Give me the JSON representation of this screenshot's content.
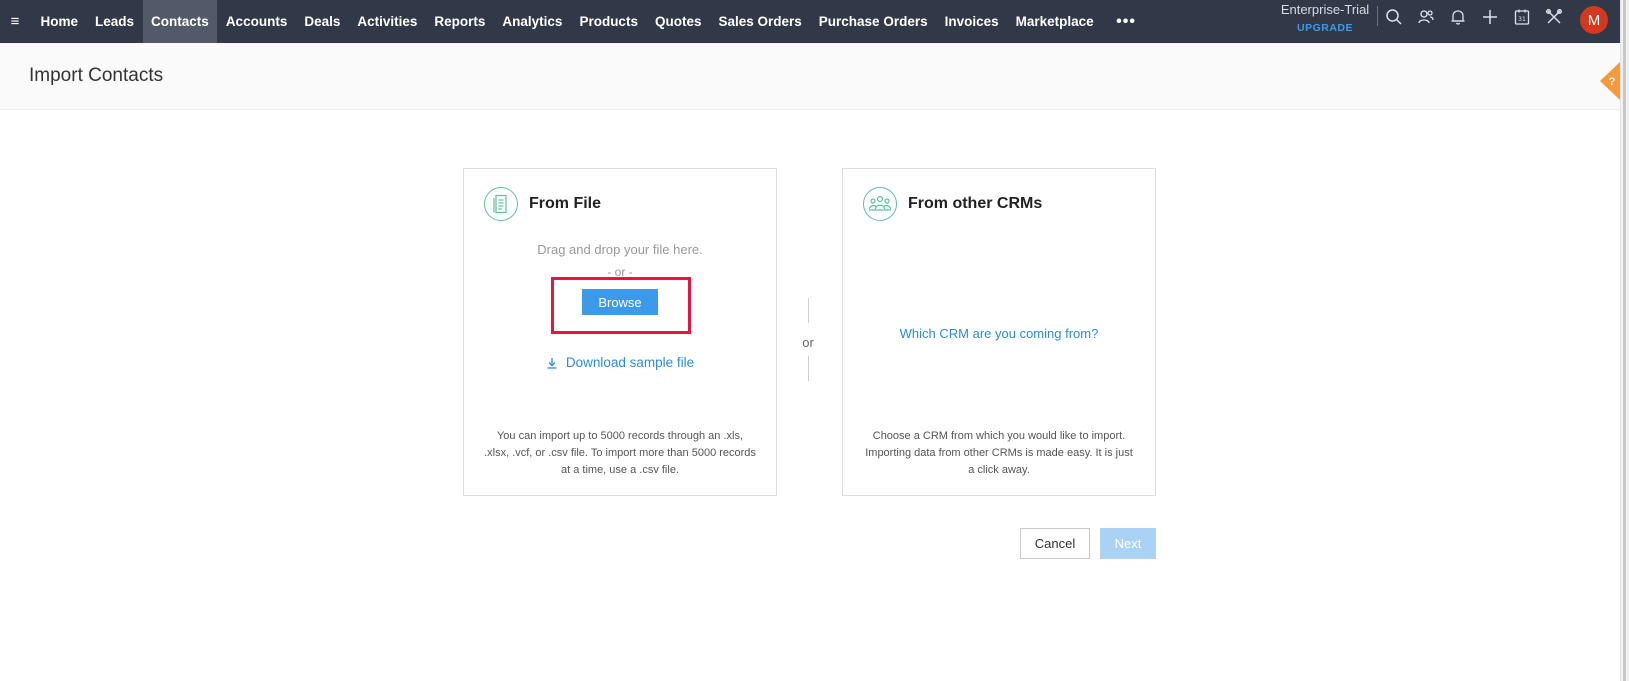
{
  "nav": {
    "items": [
      {
        "label": "Home"
      },
      {
        "label": "Leads"
      },
      {
        "label": "Contacts",
        "active": true
      },
      {
        "label": "Accounts"
      },
      {
        "label": "Deals"
      },
      {
        "label": "Activities"
      },
      {
        "label": "Reports"
      },
      {
        "label": "Analytics"
      },
      {
        "label": "Products"
      },
      {
        "label": "Quotes"
      },
      {
        "label": "Sales Orders"
      },
      {
        "label": "Purchase Orders"
      },
      {
        "label": "Invoices"
      },
      {
        "label": "Marketplace"
      }
    ],
    "more_label": "•••"
  },
  "plan": {
    "name": "Enterprise-Trial",
    "upgrade": "UPGRADE"
  },
  "user": {
    "initial": "M"
  },
  "page": {
    "title": "Import Contacts",
    "help": "?"
  },
  "from_file": {
    "title": "From File",
    "drag_text": "Drag and drop your file here.",
    "or_text": "- or -",
    "browse_label": "Browse",
    "download_label": "Download sample file",
    "note": "You can import up to 5000 records through an .xls, .xlsx, .vcf, or .csv file. To import more than 5000 records at a time, use a .csv file."
  },
  "separator": {
    "or_text": "or"
  },
  "from_crm": {
    "title": "From other CRMs",
    "link": "Which CRM are you coming from?",
    "note": "Choose a CRM from which you would like to import. Importing data from other CRMs is made easy. It is just a click away."
  },
  "actions": {
    "cancel": "Cancel",
    "next": "Next"
  },
  "colors": {
    "topbar": "#313949",
    "accent": "#3d9ae8",
    "highlight": "#e4173f",
    "icon_green": "#5cc296",
    "avatar": "#d2391f"
  },
  "icons": [
    "hamburger-icon",
    "search-icon",
    "contacts-icon",
    "bell-icon",
    "plus-icon",
    "calendar-icon",
    "tools-icon",
    "file-icon",
    "group-icon",
    "download-icon"
  ]
}
